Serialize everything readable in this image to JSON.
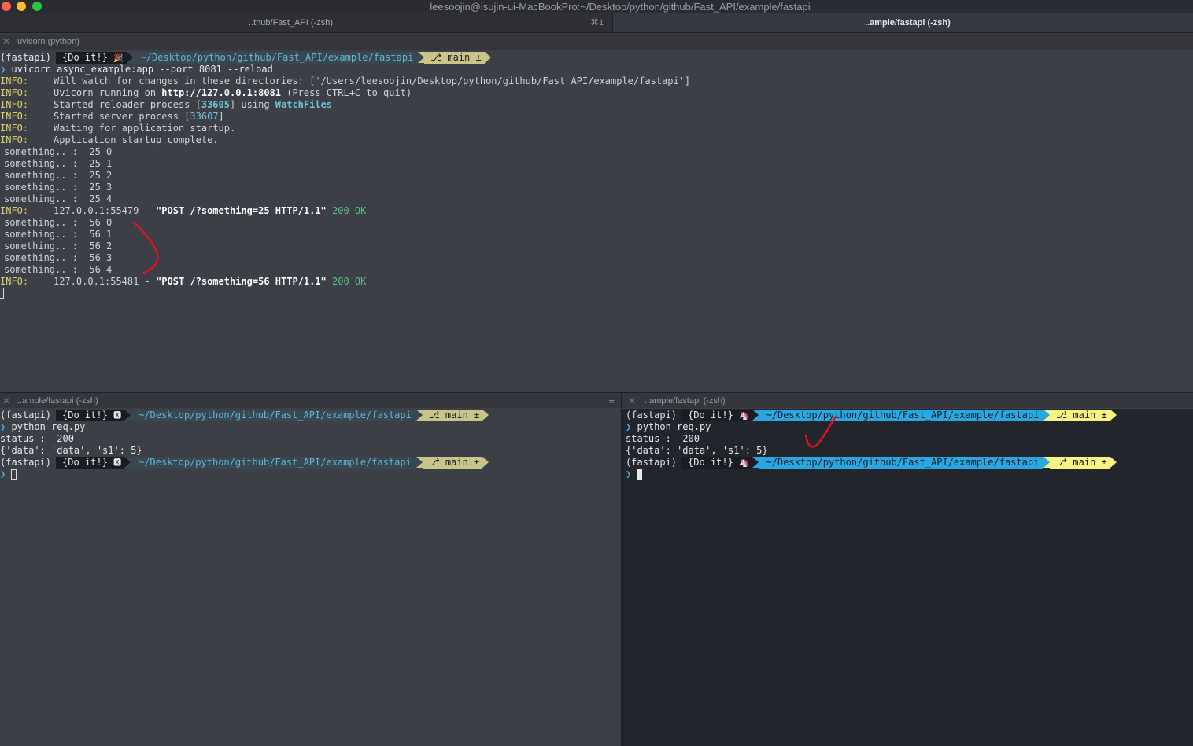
{
  "window": {
    "title": "leesoojin@isujin-ui-MacBookPro:~/Desktop/python/github/Fast_API/example/fastapi"
  },
  "tabs": [
    {
      "label": "..thub/Fast_API (-zsh)",
      "shortcut": "⌘1"
    },
    {
      "label": "..ample/fastapi (-zsh)"
    }
  ],
  "top_pane": {
    "title": "uvicorn (python)",
    "prompt": {
      "env": "(fastapi)",
      "doit": "{Do it!}",
      "emoji": "🎉",
      "path": "~/Desktop/python/github/Fast_API/example/fastapi",
      "git": "main ±"
    },
    "command": "uvicorn async_example:app --port 8081 --reload",
    "info_label": "INFO:",
    "log": {
      "watch": "Will watch for changes in these directories: ['/Users/leesoojin/Desktop/python/github/Fast_API/example/fastapi']",
      "running_pre": "Uvicorn running on ",
      "running_url": "http://127.0.0.1:8081",
      "running_post": " (Press CTRL+C to quit)",
      "reloader_pre": "Started reloader process [",
      "reloader_pid": "33605",
      "reloader_mid": "] using ",
      "reloader_tool": "WatchFiles",
      "server_pre": "Started server process [",
      "server_pid": "33607",
      "server_post": "]",
      "waiting": "Waiting for application startup.",
      "complete": "Application startup complete."
    },
    "batch1": [
      "something.. :  25 0",
      "something.. :  25 1",
      "something.. :  25 2",
      "something.. :  25 3",
      "something.. :  25 4"
    ],
    "access1": {
      "addr": "127.0.0.1:55479 - ",
      "req": "\"POST /?something=25 HTTP/1.1\"",
      "status": " 200 OK"
    },
    "batch2": [
      "something.. :  56 0",
      "something.. :  56 1",
      "something.. :  56 2",
      "something.. :  56 3",
      "something.. :  56 4"
    ],
    "access2": {
      "addr": "127.0.0.1:55481 - ",
      "req": "\"POST /?something=56 HTTP/1.1\"",
      "status": " 200 OK"
    }
  },
  "bottom_left_pane": {
    "title": "..ample/fastapi (-zsh)",
    "prompt": {
      "env": "(fastapi)",
      "doit": "{Do it!}",
      "emoji": "🆇",
      "path": "~/Desktop/python/github/Fast_API/example/fastapi",
      "git": "main ±"
    },
    "command": "python req.py",
    "status": "status :  200",
    "result": "{'data': 'data', 's1': 5}"
  },
  "bottom_right_pane": {
    "title": "..ample/fastapi (-zsh)",
    "prompt": {
      "env": "(fastapi)",
      "doit": "{Do it!}",
      "emoji": "🦄",
      "path": "~/Desktop/python/github/Fast_API/example/fastapi",
      "git": "main ±"
    },
    "command": "python req.py",
    "status": "status :  200",
    "result": "{'data': 'data', 's1': 5}"
  },
  "colors": {
    "info": "#d6cf6c",
    "ok": "#5cc389",
    "highlight": "#6ec3d9",
    "annotation": "#e0102a"
  },
  "icons": {
    "close": "✕",
    "menu": "≡",
    "prompt_arrow": "❯"
  }
}
